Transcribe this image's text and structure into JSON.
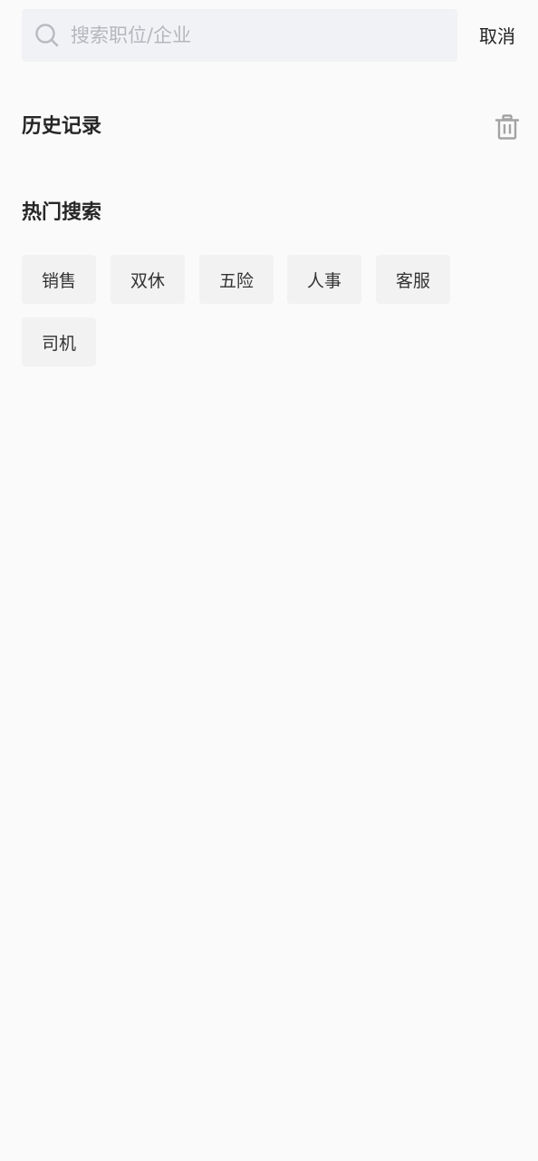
{
  "search": {
    "placeholder": "搜索职位/企业",
    "value": "",
    "icon": "search-icon",
    "cancel_label": "取消"
  },
  "history": {
    "title": "历史记录",
    "clear_icon": "trash-icon",
    "items": []
  },
  "hot": {
    "title": "热门搜索",
    "tags": [
      {
        "label": "销售"
      },
      {
        "label": "双休"
      },
      {
        "label": "五险"
      },
      {
        "label": "人事"
      },
      {
        "label": "客服"
      },
      {
        "label": "司机"
      }
    ]
  },
  "colors": {
    "background": "#fafafa",
    "search_box": "#f1f2f5",
    "tag_background": "#f2f2f2",
    "placeholder": "#b5b7bd",
    "icon_gray": "#a3a3a3"
  }
}
